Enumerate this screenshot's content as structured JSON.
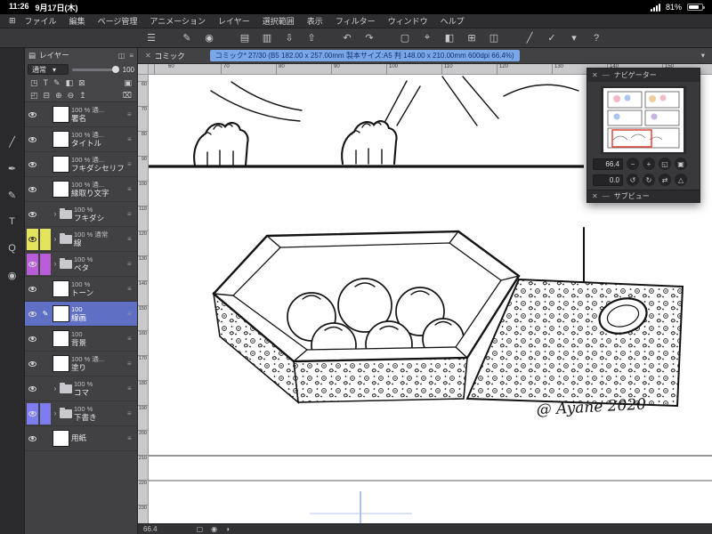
{
  "status_bar": {
    "time": "11:26",
    "date": "9月17日(木)",
    "battery_percent": "81%"
  },
  "menu_bar": {
    "apps_glyph": "⊞",
    "items": [
      "ファイル",
      "編集",
      "ページ管理",
      "アニメーション",
      "レイヤー",
      "選択範囲",
      "表示",
      "フィルター",
      "ウィンドウ",
      "ヘルプ"
    ]
  },
  "toolbar": {
    "buttons": [
      {
        "icon": "main-menu-icon",
        "glyph": "☰"
      },
      {
        "icon": "toolbar-group-divider",
        "sp": true
      },
      {
        "icon": "edit-pen-icon",
        "glyph": "✎"
      },
      {
        "icon": "color-indicator-icon",
        "glyph": "◉"
      },
      {
        "icon": "toolbar-group-divider",
        "sp": true
      },
      {
        "icon": "new-page-icon",
        "glyph": "▤"
      },
      {
        "icon": "page-manager-icon",
        "glyph": "▥"
      },
      {
        "icon": "import-icon",
        "glyph": "⇩"
      },
      {
        "icon": "export-icon",
        "glyph": "⇧"
      },
      {
        "icon": "toolbar-group-divider",
        "sp": true
      },
      {
        "icon": "undo-icon",
        "glyph": "↶"
      },
      {
        "icon": "redo-icon",
        "glyph": "↷"
      },
      {
        "icon": "toolbar-group-divider",
        "sp": true
      },
      {
        "icon": "selection-icon",
        "glyph": "▢"
      },
      {
        "icon": "transform-icon",
        "glyph": "⌖"
      },
      {
        "icon": "crop-icon",
        "glyph": "◧"
      },
      {
        "icon": "grid-icon",
        "glyph": "⊞"
      },
      {
        "icon": "snap-icon",
        "glyph": "◫"
      },
      {
        "icon": "toolbar-group-divider",
        "sp": true
      },
      {
        "icon": "ruler-icon",
        "glyph": "╱"
      },
      {
        "icon": "confirm-icon",
        "glyph": "✓"
      },
      {
        "icon": "chevron-down-icon",
        "glyph": "▾"
      },
      {
        "icon": "help-icon",
        "glyph": "?"
      }
    ]
  },
  "tool_strip": {
    "tools": [
      {
        "icon": "stroke-tool-icon",
        "glyph": "╱"
      },
      {
        "icon": "pen-tool-icon",
        "glyph": "✒"
      },
      {
        "icon": "pencil-tool-icon",
        "glyph": "✎"
      },
      {
        "icon": "text-tool-icon",
        "glyph": "T"
      },
      {
        "icon": "zoom-tool-icon",
        "glyph": "Q"
      },
      {
        "icon": "subtool-icon",
        "glyph": "◉"
      }
    ]
  },
  "layers_panel": {
    "title": "レイヤー",
    "title_glyph": "▤",
    "title_actions": [
      {
        "icon": "palette-options-icon",
        "glyph": "◫"
      },
      {
        "icon": "palette-menu-icon",
        "glyph": "≡"
      }
    ],
    "blend_mode": "通常",
    "caret_glyph": "▾",
    "opacity_value": "100",
    "header_icons_row1": [
      {
        "icon": "new-raster-layer-icon",
        "glyph": "◳"
      },
      {
        "icon": "text-layer-icon",
        "glyph": "T"
      },
      {
        "icon": "vector-layer-icon",
        "glyph": "✎"
      },
      {
        "icon": "layer-mask-icon",
        "glyph": "◧"
      },
      {
        "icon": "clip-layer-icon",
        "glyph": "⊠"
      },
      {
        "icon": "layer-property-icon",
        "glyph": "▣"
      }
    ],
    "header_icons_row2": [
      {
        "icon": "new-folder-icon",
        "glyph": "◰"
      },
      {
        "icon": "merge-down-icon",
        "glyph": "⊟"
      },
      {
        "icon": "add-layer-icon",
        "glyph": "⊕"
      },
      {
        "icon": "remove-layer-icon",
        "glyph": "⊖"
      },
      {
        "icon": "move-up-icon",
        "glyph": "↥"
      },
      {
        "icon": "delete-layer-icon",
        "glyph": "⌧"
      }
    ],
    "icons": {
      "arrow": "›",
      "menu": "≡",
      "edit": "✎"
    },
    "layers": [
      {
        "info": "100 % 通...",
        "name": "署名",
        "thumb": true
      },
      {
        "info": "100 % 通...",
        "name": "タイトル",
        "thumb": true
      },
      {
        "info": "100 % 通...",
        "name": "フキダシセリフ",
        "thumb": true
      },
      {
        "info": "100 % 通...",
        "name": "縁取り文字",
        "thumb": true
      },
      {
        "info": "100 %",
        "name": "フキダシ",
        "folder": true
      },
      {
        "info": "100 % 通常",
        "name": "線",
        "folder": true,
        "color": "yellow"
      },
      {
        "info": "100 %",
        "name": "ベタ",
        "folder": true,
        "color": "purple"
      },
      {
        "info": "100 %",
        "name": "トーン",
        "thumb": true
      },
      {
        "info": "100",
        "name": "線画",
        "thumb": true,
        "selected": true,
        "edit": true
      },
      {
        "info": "100",
        "name": "背景",
        "thumb": true
      },
      {
        "info": "100 % 通...",
        "name": "塗り",
        "thumb": true
      },
      {
        "info": "100 %",
        "name": "コマ",
        "folder": true
      },
      {
        "info": "100 %",
        "name": "下書き",
        "folder": true,
        "color": "blue"
      },
      {
        "info": "",
        "name": "用紙",
        "thumb": true,
        "single": true
      }
    ]
  },
  "document": {
    "tab_close_glyph": "✕",
    "tab": "コミック",
    "title": "コミック* 27/30 (B5 182.00 x 257.00mm 製本サイズ:A5 判 148.00 x 210.00mm 600dpi 66.4%)",
    "caret_glyph": "▾"
  },
  "rulers": {
    "top": [
      "60",
      "70",
      "80",
      "90",
      "100",
      "110",
      "120",
      "130",
      "140",
      "150"
    ],
    "left": [
      "60",
      "70",
      "80",
      "90",
      "100",
      "110",
      "120",
      "130",
      "140",
      "150",
      "160",
      "170",
      "180",
      "190",
      "200",
      "210",
      "220",
      "230"
    ]
  },
  "canvas": {
    "signature": "@ Ayane 2020"
  },
  "navigator": {
    "close_glyph": "✕",
    "collapse_glyph": "—",
    "title": "ナビゲーター",
    "zoom_value": "66.4",
    "rotate_value": "0.0",
    "zoom_buttons": [
      {
        "icon": "zoom-out-icon",
        "glyph": "−"
      },
      {
        "icon": "zoom-in-icon",
        "glyph": "+"
      },
      {
        "icon": "zoom-100-icon",
        "glyph": "◱"
      },
      {
        "icon": "fit-to-screen-icon",
        "glyph": "▣"
      }
    ],
    "rotate_buttons": [
      {
        "icon": "rotate-left-icon",
        "glyph": "↺"
      },
      {
        "icon": "rotate-right-icon",
        "glyph": "↻"
      },
      {
        "icon": "flip-horizontal-icon",
        "glyph": "⇄"
      },
      {
        "icon": "reset-rotation-icon",
        "glyph": "△"
      }
    ],
    "subview": {
      "title": "サブビュー",
      "close_glyph": "✕",
      "collapse_glyph": "—"
    }
  },
  "bottom_bar": {
    "zoom_value": "66.4",
    "icons": [
      {
        "icon": "zoom-indicator-icon",
        "glyph": "▢"
      },
      {
        "icon": "rotate-indicator-icon",
        "glyph": "◉"
      },
      {
        "icon": "view-mode-icon",
        "glyph": "◑"
      }
    ]
  },
  "colors": {
    "selected_layer": "#5f6fc4",
    "layer_color_yellow": "#e3e35c",
    "layer_color_purple": "#b95ed8",
    "layer_color_blue": "#7d7df0",
    "title_highlight": "#7aa7e8",
    "navigator_view_rect": "#e0392e"
  }
}
